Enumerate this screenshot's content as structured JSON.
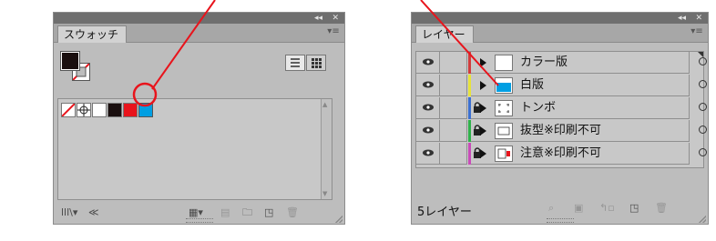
{
  "swatches_panel": {
    "tab_label": "スウォッチ",
    "collapse_icon": "collapse-double-arrow-icon",
    "close_icon": "close-icon",
    "menu_icon": "panel-menu-icon",
    "view_buttons": [
      "list-view-icon",
      "thumbnail-view-icon"
    ],
    "swatches": [
      {
        "name": "none",
        "color": "#ffffff"
      },
      {
        "name": "registration",
        "color": "#ffffff"
      },
      {
        "name": "white",
        "color": "#ffffff"
      },
      {
        "name": "black",
        "color": "#1a0f0f"
      },
      {
        "name": "red",
        "color": "#e8141c"
      },
      {
        "name": "cyan",
        "color": "#009fe3"
      }
    ],
    "footer_icons": [
      "swatch-libraries-icon",
      "show-swatch-kinds-icon",
      "swatch-options-icon",
      "new-color-group-icon",
      "new-swatch-icon",
      "delete-swatch-icon"
    ]
  },
  "layers_panel": {
    "tab_label": "レイヤー",
    "collapse_icon": "collapse-double-arrow-icon",
    "close_icon": "close-icon",
    "menu_icon": "panel-menu-icon",
    "layers": [
      {
        "name": "カラー版",
        "locked": false,
        "color": "#d13b3b",
        "selected": false
      },
      {
        "name": "白版",
        "locked": false,
        "color": "#e6e23a",
        "selected": false
      },
      {
        "name": "トンボ",
        "locked": true,
        "color": "#3b6fd1",
        "selected": false
      },
      {
        "name": "抜型※印刷不可",
        "locked": true,
        "color": "#2fb24a",
        "selected": false
      },
      {
        "name": "注意※印刷不可",
        "locked": true,
        "color": "#c84bb8",
        "selected": false
      }
    ],
    "footer_count": "5レイヤー",
    "footer_icons": [
      "locate-object-icon",
      "make-clipping-mask-icon",
      "create-sublayer-icon",
      "create-new-layer-icon",
      "delete-layer-icon"
    ]
  },
  "annotation": {
    "line_color": "#e8141c"
  }
}
